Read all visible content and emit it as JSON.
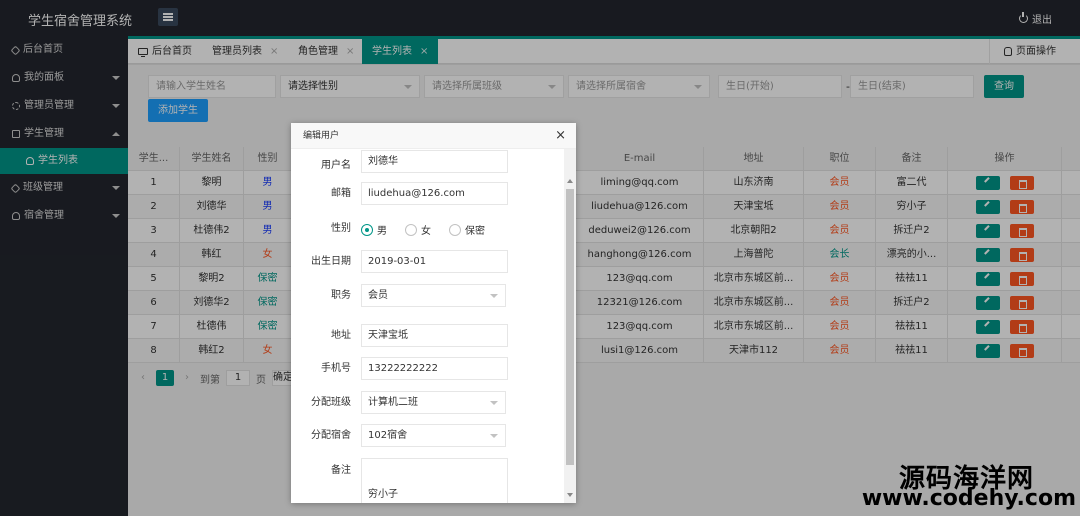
{
  "header": {
    "title": "学生宿舍管理系统",
    "logout_label": "退出"
  },
  "sidebar": {
    "items": [
      {
        "label": "后台首页",
        "icon": "home-icon"
      },
      {
        "label": "我的面板",
        "icon": "user-icon"
      },
      {
        "label": "管理员管理",
        "icon": "gear-icon"
      },
      {
        "label": "学生管理",
        "icon": "lock-icon"
      },
      {
        "label": "学生列表",
        "icon": "user-icon"
      },
      {
        "label": "班级管理",
        "icon": "home-icon"
      },
      {
        "label": "宿舍管理",
        "icon": "user-icon"
      }
    ]
  },
  "tabs": [
    {
      "label": "后台首页"
    },
    {
      "label": "管理员列表"
    },
    {
      "label": "角色管理"
    },
    {
      "label": "学生列表"
    }
  ],
  "page_ops_label": "页面操作",
  "filters": {
    "name_placeholder": "请输入学生姓名",
    "gender": "请选择性别",
    "class": "请选择所属班级",
    "dorm": "请选择所属宿舍",
    "birth_start": "生日(开始)",
    "birth_end": "生日(结束)",
    "dash": "-",
    "query_label": "查询",
    "add_label": "添加学生"
  },
  "table": {
    "headers": [
      "学生...",
      "学生姓名",
      "性别",
      "E-mail",
      "地址",
      "职位",
      "备注",
      "操作"
    ],
    "rows": [
      {
        "id": "1",
        "name": "黎明",
        "gender": "男",
        "email": "liming@qq.com",
        "address": "山东济南",
        "role": "会员",
        "note": "富二代"
      },
      {
        "id": "2",
        "name": "刘德华",
        "gender": "男",
        "email": "liudehua@126.com",
        "address": "天津宝坻",
        "role": "会员",
        "note": "穷小子"
      },
      {
        "id": "3",
        "name": "杜德伟2",
        "gender": "男",
        "email": "deduwei2@126.com",
        "address": "北京朝阳2",
        "role": "会员",
        "note": "拆迁户2"
      },
      {
        "id": "4",
        "name": "韩红",
        "gender": "女",
        "email": "hanghong@126.com",
        "address": "上海普陀",
        "role": "会长",
        "note": "漂亮的小..."
      },
      {
        "id": "5",
        "name": "黎明2",
        "gender": "保密",
        "email": "123@qq.com",
        "address": "北京市东城区前...",
        "role": "会员",
        "note": "祛祛11"
      },
      {
        "id": "6",
        "name": "刘德华2",
        "gender": "保密",
        "email": "12321@126.com",
        "address": "北京市东城区前...",
        "role": "会员",
        "note": "拆迁户2"
      },
      {
        "id": "7",
        "name": "杜德伟",
        "gender": "保密",
        "email": "123@qq.com",
        "address": "北京市东城区前...",
        "role": "会员",
        "note": "祛祛11"
      },
      {
        "id": "8",
        "name": "韩红2",
        "gender": "女",
        "email": "lusi1@126.com",
        "address": "天津市112",
        "role": "会员",
        "note": "祛祛11"
      }
    ]
  },
  "pager": {
    "prev": "‹",
    "current": "1",
    "next": "›",
    "goto_label": "到第",
    "page_value": "1",
    "page_unit": "页",
    "confirm_label": "确定"
  },
  "modal": {
    "title": "编辑用户",
    "close": "×",
    "fields": {
      "username_label": "用户名",
      "username": "刘德华",
      "email_label": "邮箱",
      "email": "liudehua@126.com",
      "gender_label": "性别",
      "gender_options": [
        "男",
        "女",
        "保密"
      ],
      "gender_selected": "男",
      "birth_label": "出生日期",
      "birth": "2019-03-01",
      "role_label": "职务",
      "role": "会员",
      "address_label": "地址",
      "address": "天津宝坻",
      "phone_label": "手机号",
      "phone": "13222222222",
      "class_label": "分配班级",
      "class": "计算机二班",
      "dorm_label": "分配宿舍",
      "dorm": "102宿舍",
      "note_label": "备注",
      "note": "穷小子"
    }
  },
  "watermark": {
    "line1": "源码海洋网",
    "line2": "www.codehy.com"
  },
  "colors": {
    "accent": "#009688",
    "danger": "#ff5722",
    "primary": "#1e9fff",
    "header_bg": "#23262e"
  }
}
